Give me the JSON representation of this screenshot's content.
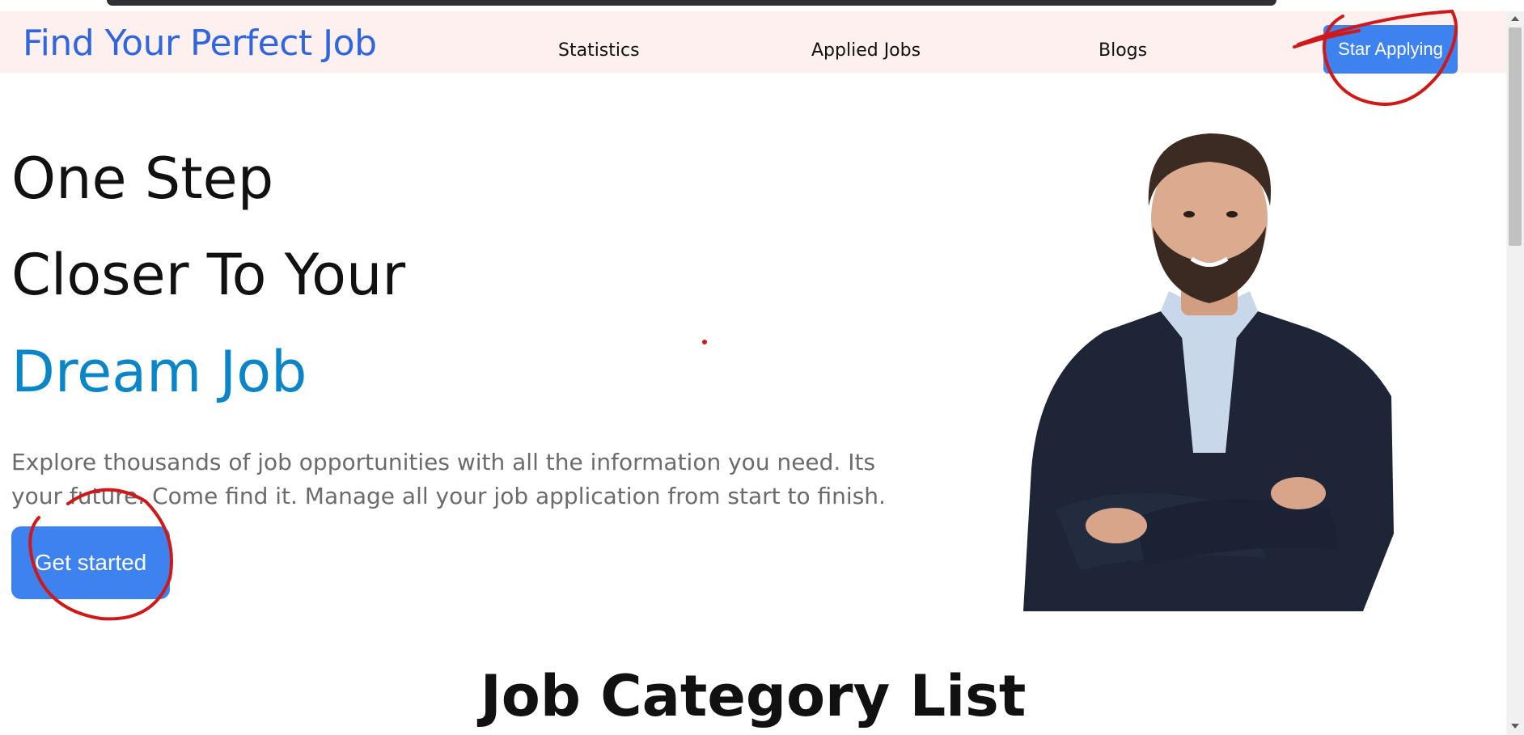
{
  "navbar": {
    "brand": "Find Your Perfect Job",
    "links": [
      "Statistics",
      "Applied Jobs",
      "Blogs"
    ],
    "cta_label": "Star Applying"
  },
  "hero": {
    "line1": "One Step",
    "line2": "Closer To Your",
    "line3": "Dream Job",
    "description": "Explore thousands of job opportunities with all the information you need. Its your future. Come find it. Manage all your job application from start to finish.",
    "button_label": "Get started"
  },
  "section": {
    "title": "Job Category List"
  },
  "colors": {
    "brand": "#2f66e0",
    "accent": "#0a86c8",
    "button": "#3d82ef",
    "navbar_bg": "#fdf0ef",
    "annotation": "#d01818"
  }
}
